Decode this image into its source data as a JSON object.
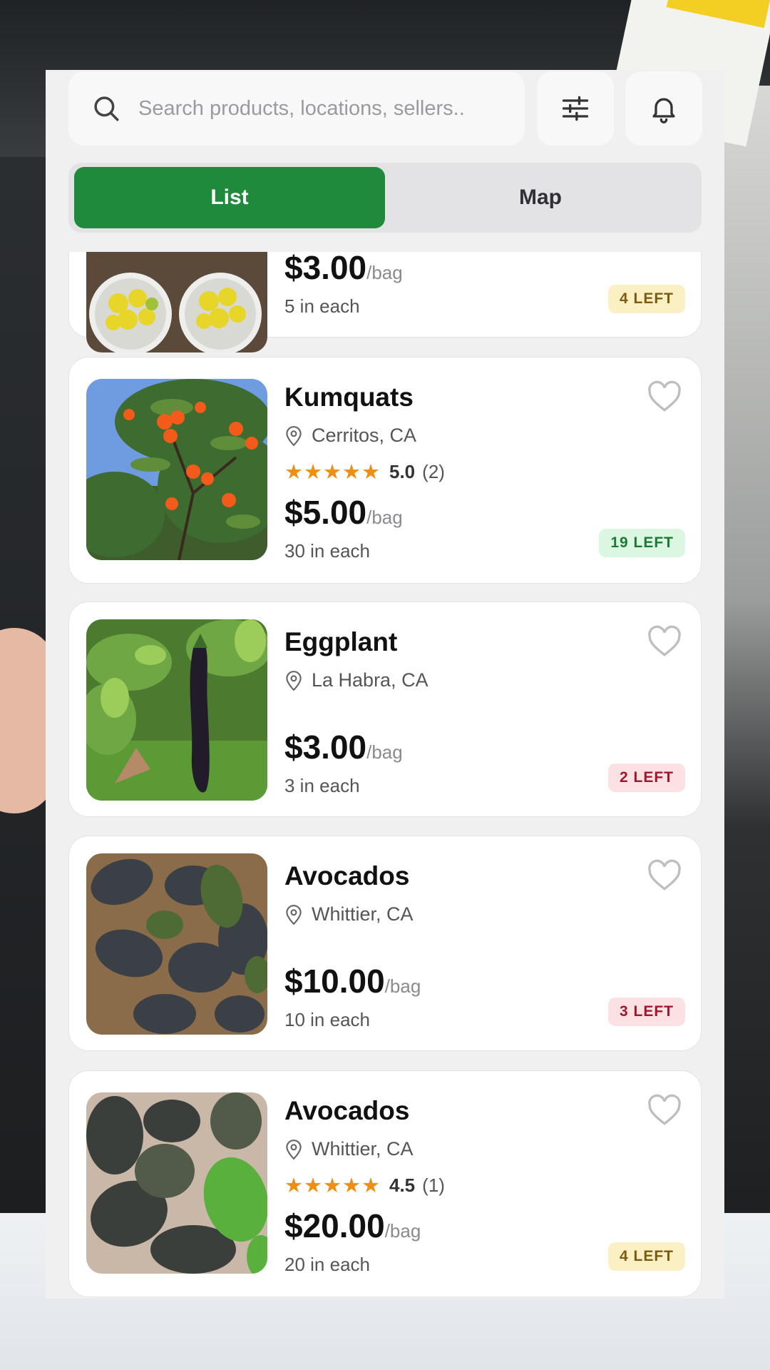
{
  "search": {
    "placeholder": "Search products, locations, sellers.."
  },
  "icons": {
    "search": "search-icon",
    "filter": "sliders-icon",
    "bell": "bell-icon",
    "location": "location-pin-icon",
    "favorite": "heart-icon"
  },
  "tabs": {
    "list": "List",
    "map": "Map",
    "active": "List"
  },
  "colors": {
    "accent": "#1f8a3c",
    "star": "#ec8f12"
  },
  "listings": [
    {
      "title": "",
      "location": "",
      "price": "$3.00",
      "unit": "/bag",
      "each": "5 in each",
      "left": "4 LEFT",
      "badge": "yellow",
      "image": "lemons"
    },
    {
      "title": "Kumquats",
      "location": "Cerritos, CA",
      "stars": "★★★★★",
      "rating": "5.0",
      "reviews": "(2)",
      "price": "$5.00",
      "unit": "/bag",
      "each": "30 in each",
      "left": "19 LEFT",
      "badge": "green",
      "image": "kumquat-tree"
    },
    {
      "title": "Eggplant",
      "location": "La Habra, CA",
      "price": "$3.00",
      "unit": "/bag",
      "each": "3 in each",
      "left": "2 LEFT",
      "badge": "red",
      "image": "eggplant-plant"
    },
    {
      "title": "Avocados",
      "location": "Whittier, CA",
      "price": "$10.00",
      "unit": "/bag",
      "each": "10 in each",
      "left": "3 LEFT",
      "badge": "red",
      "image": "avocados-pile"
    },
    {
      "title": "Avocados",
      "location": "Whittier, CA",
      "stars": "★★★★★",
      "rating": "4.5",
      "reviews": "(1)",
      "price": "$20.00",
      "unit": "/bag",
      "each": "20 in each",
      "left": "4 LEFT",
      "badge": "yellow",
      "image": "avocados-box"
    }
  ]
}
